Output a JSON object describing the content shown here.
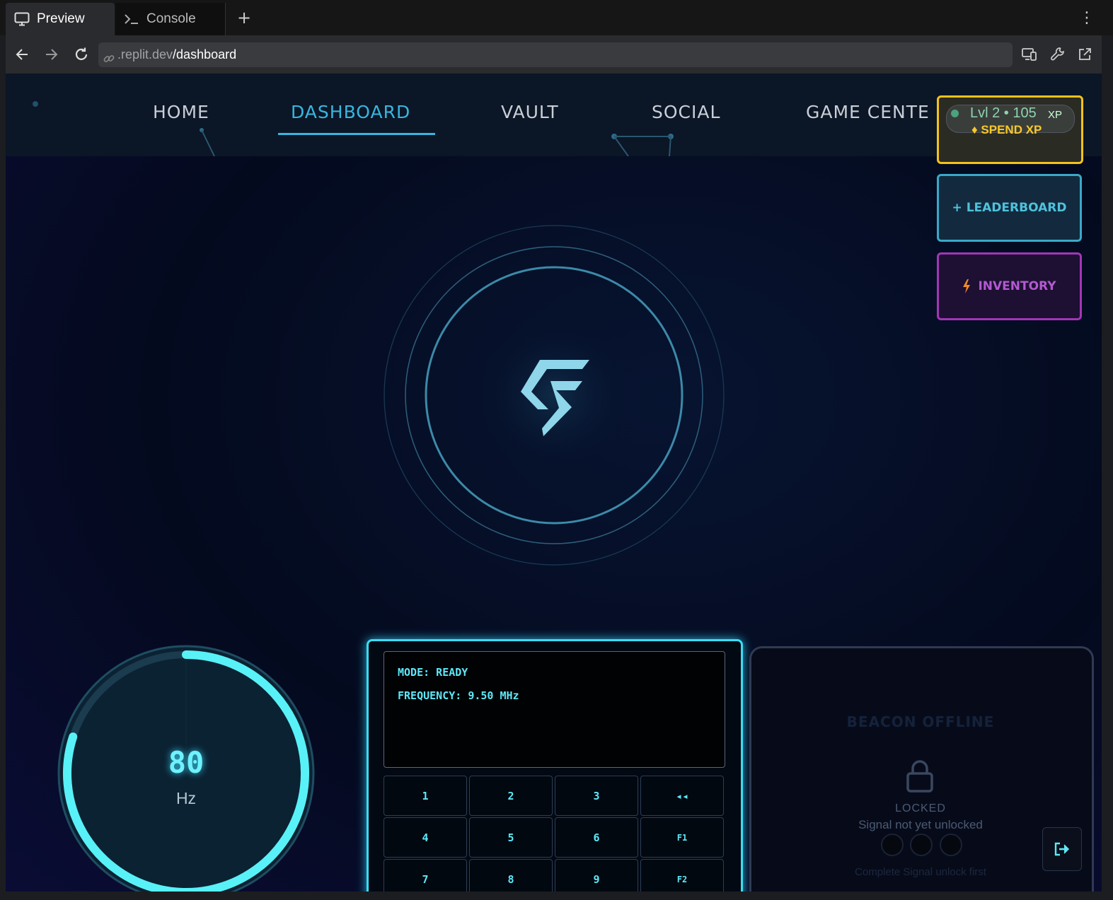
{
  "browser": {
    "tabs": [
      {
        "label": "Preview",
        "icon": "monitor-icon",
        "active": true
      },
      {
        "label": "Console",
        "icon": "terminal-icon",
        "active": false
      }
    ],
    "new_tab": "+",
    "url_host": ".replit.dev",
    "url_path": "/dashboard"
  },
  "nav": {
    "items": [
      {
        "label": "HOME",
        "active": false
      },
      {
        "label": "DASHBOARD",
        "active": true
      },
      {
        "label": "VAULT",
        "active": false
      },
      {
        "label": "SOCIAL",
        "active": false
      },
      {
        "label": "GAME CENTE",
        "active": false
      }
    ]
  },
  "xp": {
    "level_text": "Lvl 2 • 105",
    "unit": "XP",
    "spend_label": "♦ SPEND XP"
  },
  "side_buttons": {
    "leaderboard": "+ LEADERBOARD",
    "inventory": "INVENTORY"
  },
  "dial": {
    "value": "80",
    "unit": "Hz",
    "fill_fraction": 0.8
  },
  "console": {
    "mode": "MODE: READY",
    "frequency": "FREQUENCY: 9.50 MHz",
    "keys": [
      [
        "1",
        "2",
        "3",
        "◂◂"
      ],
      [
        "4",
        "5",
        "6",
        "F1"
      ],
      [
        "7",
        "8",
        "9",
        "F2"
      ]
    ]
  },
  "beacon": {
    "title": "BEACON OFFLINE",
    "locked": "LOCKED",
    "subtitle": "Signal not yet unlocked",
    "hint": "Complete Signal unlock first"
  },
  "colors": {
    "accent": "#38b6df",
    "xp_gold": "#f4c21b",
    "inventory_purple": "#a236b6",
    "console_cyan": "#3bdcf3"
  }
}
